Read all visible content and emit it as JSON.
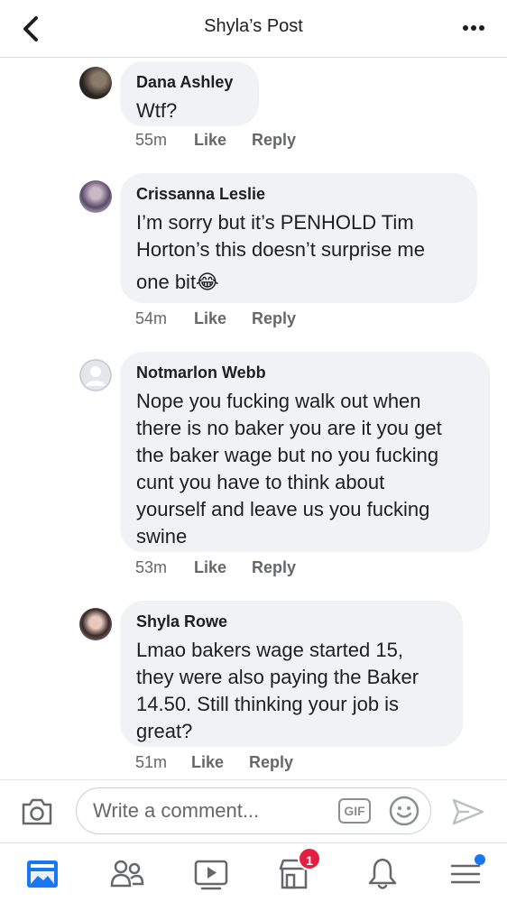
{
  "header": {
    "title": "Shyla’s Post"
  },
  "comments": [
    {
      "author": "Dana Ashley",
      "text": "Wtf?",
      "time": "55m",
      "like_label": "Like",
      "reply_label": "Reply"
    },
    {
      "author": "Crissanna Leslie",
      "text_lines": [
        "I’m sorry but it’s PENHOLD Tim",
        "Horton’s this doesn’t surprise me",
        "one bit😂"
      ],
      "time": "54m",
      "like_label": "Like",
      "reply_label": "Reply"
    },
    {
      "author": "Notmarlon Webb",
      "text_lines": [
        "Nope you fucking walk out when",
        "there is no baker you are it you get",
        "the baker wage but no you fucking",
        "cunt you have to think about",
        "yourself and leave us you fucking",
        "swine"
      ],
      "time": "53m",
      "like_label": "Like",
      "reply_label": "Reply"
    },
    {
      "author": "Shyla Rowe",
      "text_lines": [
        "Lmao bakers wage started 15,",
        "they were also paying the Baker",
        "14.50. Still thinking your job is",
        "great?"
      ],
      "time": "51m",
      "like_label": "Like",
      "reply_label": "Reply"
    }
  ],
  "composer": {
    "placeholder": "Write a comment...",
    "gif_label": "GIF"
  },
  "bottom_nav": {
    "items": [
      "news-feed-icon",
      "friends-icon",
      "watch-icon",
      "marketplace-icon",
      "notifications-icon",
      "menu-icon"
    ],
    "marketplace_badge": "1"
  },
  "colors": {
    "bubble": "#f0f2f5",
    "meta_text": "#65676b",
    "badge": "#e41e3f",
    "active_blue": "#1877f2"
  }
}
